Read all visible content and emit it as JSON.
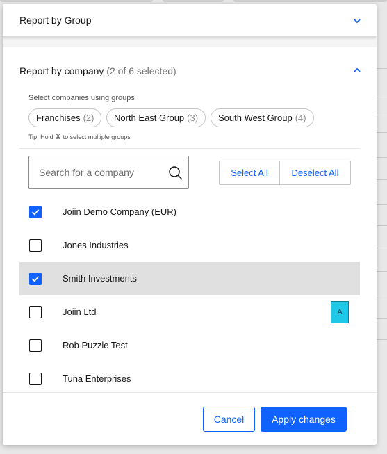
{
  "accordion_collapsed": {
    "title": "Report by Group"
  },
  "panel": {
    "title": "Report by company",
    "selection_count": "(2 of 6 selected)",
    "groups_label": "Select companies using groups",
    "groups": [
      {
        "label": "Franchises",
        "count": "(2)"
      },
      {
        "label": "North East Group",
        "count": "(3)"
      },
      {
        "label": "South West Group",
        "count": "(4)"
      }
    ],
    "tip": "Tip: Hold ⌘ to select multiple groups",
    "search": {
      "placeholder": "Search for a company",
      "value": ""
    },
    "select_all_label": "Select All",
    "deselect_all_label": "Deselect All",
    "companies": [
      {
        "label": "Joiin Demo Company (EUR)",
        "checked": true
      },
      {
        "label": "Jones Industries",
        "checked": false
      },
      {
        "label": "Smith Investments",
        "checked": true,
        "highlighted": true
      },
      {
        "label": "Joiin Ltd",
        "checked": false,
        "badge": "A"
      },
      {
        "label": "Rob Puzzle Test",
        "checked": false
      },
      {
        "label": "Tuna Enterprises",
        "checked": false
      }
    ]
  },
  "footer": {
    "cancel_label": "Cancel",
    "apply_label": "Apply changes"
  },
  "colors": {
    "primary": "#0f62fe",
    "badge": "#1ec8e6",
    "row_highlight": "#e0e0e0"
  },
  "icons": [
    "chevron-down-icon",
    "chevron-up-icon",
    "search-icon",
    "checkmark-icon"
  ]
}
